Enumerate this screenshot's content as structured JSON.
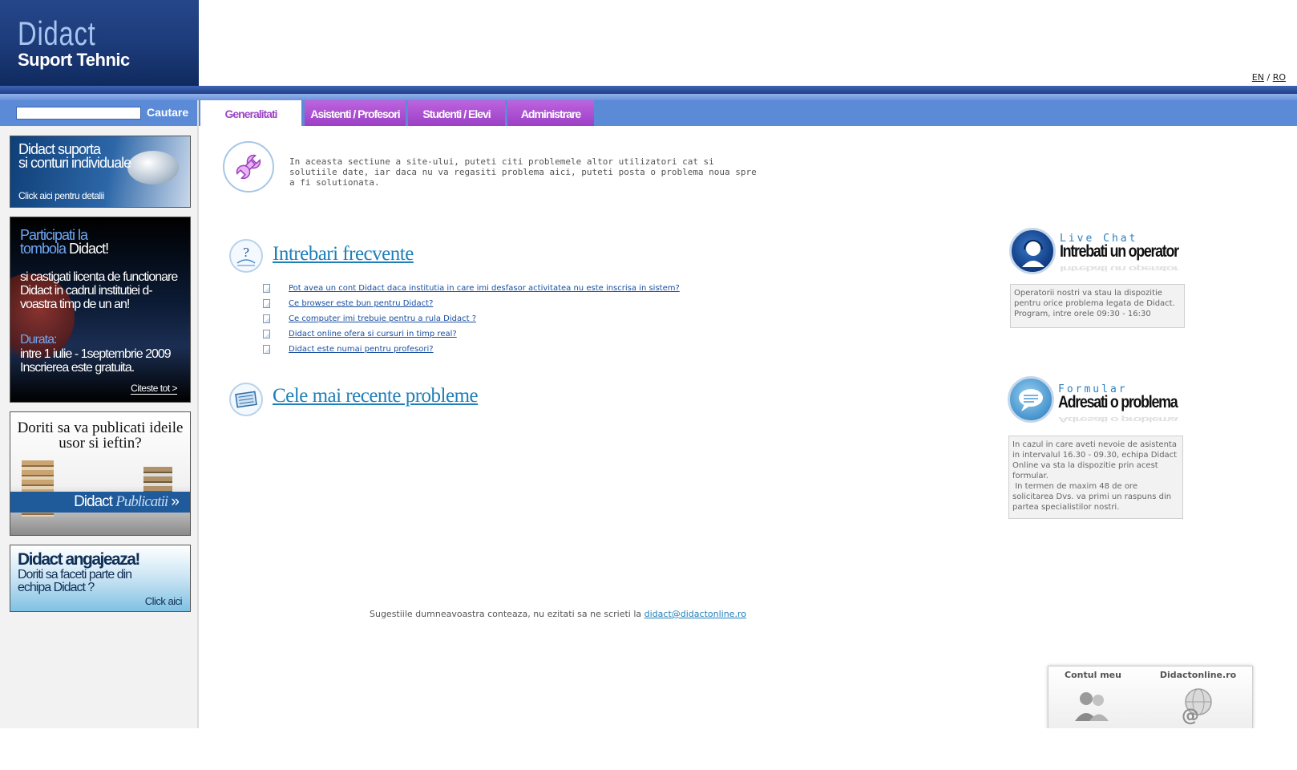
{
  "header": {
    "brand": "Didact",
    "subtitle": "Suport Tehnic",
    "lang_en": "EN",
    "lang_sep": "/",
    "lang_ro": "RO"
  },
  "search": {
    "button_label": "Cautare",
    "value": ""
  },
  "tabs": [
    {
      "label": "Generalitati",
      "active": true
    },
    {
      "label": "Asistenti / Profesori",
      "active": false
    },
    {
      "label": "Studenti / Elevi",
      "active": false
    },
    {
      "label": "Administrare",
      "active": false
    }
  ],
  "banners": {
    "b1": {
      "line1": "Didact suporta",
      "line2": "si conturi individuale",
      "cta": "Click aici pentru detalii"
    },
    "b2": {
      "title": "Participati la",
      "title2a": "tombola ",
      "title2b": "Didact!",
      "body": "si castigati licenta de functionare Didact in cadrul institutiei d-voastra timp de un an!",
      "durata_label": "Durata:",
      "durata": "intre 1 iulie - 1septembrie 2009 Inscrierea este gratuita.",
      "cta": "Citeste tot >"
    },
    "b3": {
      "line1": "Doriti sa va publicati ideile",
      "line2": "usor si ieftin?",
      "logo_a": "Didact ",
      "logo_b": "Publicatii",
      "logo_arrow": " »"
    },
    "b4": {
      "title": "Didact angajeaza!",
      "line1": "Doriti sa faceti parte din",
      "line2": "echipa Didact ?",
      "cta": "Click aici"
    }
  },
  "intro": {
    "text": "In aceasta sectiune a site-ului, puteti citi problemele altor utilizatori cat si solutiile date, iar daca nu va regasiti problema aici, puteti posta o problema noua spre a fi solutionata."
  },
  "faq": {
    "title": "Intrebari frecvente",
    "items": [
      "Pot avea un cont Didact daca institutia in care imi desfasor activitatea nu este inscrisa in sistem?",
      "Ce browser este bun pentru Didact?",
      "Ce computer imi trebuie pentru a rula Didact ?",
      "Didact online ofera si cursuri in timp real?",
      "Didact este numai pentru profesori?"
    ]
  },
  "recent": {
    "title": "Cele mai recente probleme"
  },
  "chat": {
    "small": "Live Chat",
    "big": "Intrebati un operator",
    "info": "Operatorii nostri va stau la dispozitie pentru orice problema legata de Didact. Program, intre orele 09:30 - 16:30"
  },
  "form": {
    "small": "Formular",
    "big": "Adresati o problema",
    "info1": "In cazul in care aveti nevoie de asistenta in intervalul 16.30 - 09.30, echipa Didact Online va sta la dispozitie prin acest formular.",
    "info2": "In termen de maxim 48 de ore solicitarea Dvs. va primi un raspuns din partea specialistilor nostri."
  },
  "footer": {
    "suggest": "Sugestiile dumneavoastra conteaza, nu ezitati sa ne scrieti la ",
    "email": "didact@didactonline.ro"
  },
  "quick": {
    "account": "Contul meu",
    "site": "Didactonline.ro"
  },
  "colors": {
    "tab_purple": "#9b40c6",
    "nav_blue": "#5b8ad7",
    "header_navy": "#1c3a78",
    "link_blue": "#1e7fb9"
  }
}
